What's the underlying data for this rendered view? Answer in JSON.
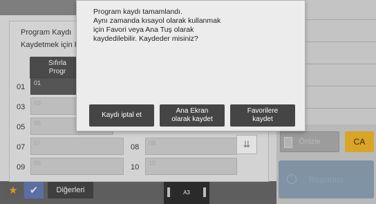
{
  "background": {
    "onizle_label": "Önizle",
    "ca_label": "CA",
    "baslat_label": "Başlatma",
    "paper_size": "A3"
  },
  "program_window": {
    "title": "Program Kaydı",
    "subtitle": "Kaydetmek için P",
    "reset_button_line1": "Sıfırla",
    "reset_button_line2": "Progr",
    "slots": [
      {
        "num": "01",
        "label": "01"
      },
      {
        "num": "03",
        "label": "03"
      },
      {
        "num": "05",
        "label": "05"
      },
      {
        "num": "07",
        "label": "07"
      },
      {
        "num": "08",
        "label": "08"
      },
      {
        "num": "09",
        "label": "09"
      },
      {
        "num": "10",
        "label": "10"
      }
    ],
    "scroll_glyph": "⇊",
    "star_glyph": "★",
    "check_glyph": "✔",
    "others_label": "Diğerleri"
  },
  "dialog": {
    "message_lines": [
      "Program kaydı tamamlandı.",
      "Aynı zamanda kısayol olarak kullanmak",
      "için Favori veya Ana Tuş olarak",
      "kaydedilebilir. Kaydeder misiniz?"
    ],
    "cancel_label": "Kaydı iptal et",
    "home_line1": "Ana Ekran",
    "home_line2": "olarak kaydet",
    "fav_line1": "Favorilere",
    "fav_line2": "kaydet"
  },
  "colors": {
    "accent_ca": "#d8a526",
    "dialog_button": "#454545",
    "start_button": "#7f93a4"
  }
}
